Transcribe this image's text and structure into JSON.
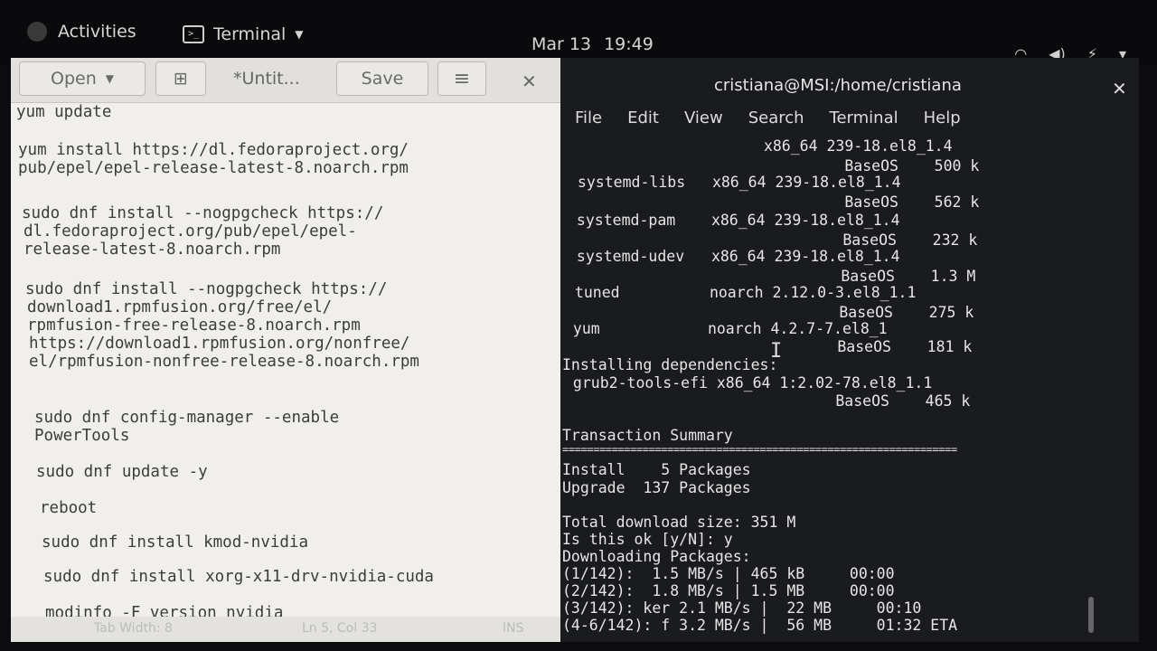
{
  "topbar": {
    "activities": "Activities",
    "app_menu": "Terminal",
    "date": "Mar 13",
    "time": "19:49",
    "icons": [
      "wifi-icon",
      "volume-icon",
      "power-icon",
      "system-menu-caret-icon"
    ]
  },
  "gedit": {
    "open_label": "Open",
    "doc_title": "*Untit...",
    "save_label": "Save",
    "lines": [
      "yum update",
      "yum install https://dl.fedoraproject.org/",
      "pub/epel/epel-release-latest-8.noarch.rpm",
      "sudo dnf install --nogpgcheck https://",
      "dl.fedoraproject.org/pub/epel/epel-",
      "release-latest-8.noarch.rpm",
      "sudo dnf install --nogpgcheck https://",
      "download1.rpmfusion.org/free/el/",
      "rpmfusion-free-release-8.noarch.rpm",
      "https://download1.rpmfusion.org/nonfree/",
      "el/rpmfusion-nonfree-release-8.noarch.rpm",
      "sudo dnf config-manager --enable",
      "PowerTools",
      "sudo dnf update -y",
      "reboot",
      "sudo dnf install kmod-nvidia",
      "sudo dnf install xorg-x11-drv-nvidia-cuda",
      "modinfo -F version nvidia"
    ],
    "status": {
      "tab_width": "Tab Width: 8",
      "position": "Ln 5, Col 33",
      "mode": "INS"
    }
  },
  "terminal": {
    "title": "cristiana@MSI:/home/cristiana",
    "menu": [
      "File",
      "Edit",
      "View",
      "Search",
      "Terminal",
      "Help"
    ],
    "lines": [
      "                x86_64 239-18.el8_1.4",
      "                         BaseOS    500 k",
      " systemd-libs   x86_64 239-18.el8_1.4",
      "                         BaseOS    562 k",
      " systemd-pam    x86_64 239-18.el8_1.4",
      "                         BaseOS    232 k",
      " systemd-udev   x86_64 239-18.el8_1.4",
      "                         BaseOS    1.3 M",
      " tuned          noarch 2.12.0-3.el8_1.1",
      "                         BaseOS    275 k",
      " yum            noarch 4.2.7-7.el8_1",
      "                         BaseOS    181 k",
      "Installing dependencies:",
      " grub2-tools-efi x86_64 1:2.02-78.el8_1.1",
      "                         BaseOS    465 k",
      "",
      "Transaction Summary",
      "================================================================",
      "Install    5 Packages",
      "Upgrade  137 Packages",
      "",
      "Total download size: 351 M",
      "Is this ok [y/N]: y",
      "Downloading Packages:",
      "(1/142):  1.5 MB/s | 465 kB     00:00",
      "(2/142):  1.8 MB/s | 1.5 MB     00:00",
      "(3/142): ker 2.1 MB/s |  22 MB     00:10",
      "(4-6/142): f 3.2 MB/s |  56 MB     01:32 ETA"
    ]
  }
}
